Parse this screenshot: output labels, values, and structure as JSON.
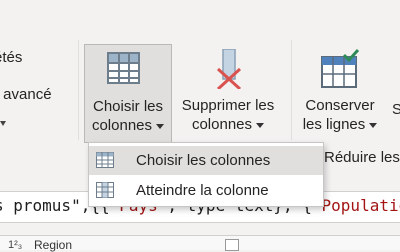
{
  "ribbon": {
    "left_clipped": {
      "line1": "étés",
      "line2": "r avancé"
    },
    "choose_columns": {
      "line1": "Choisir les",
      "line2": "colonnes"
    },
    "delete_columns": {
      "line1": "Supprimer les",
      "line2": "colonnes"
    },
    "keep_rows": {
      "line1": "Conserver",
      "line2": "les lignes"
    },
    "right_clipped": {
      "line1": "S"
    },
    "reduce_rows": "Réduire les"
  },
  "dropdown": {
    "items": [
      {
        "label": "Choisir les colonnes",
        "icon": "table-grid-icon"
      },
      {
        "label": "Atteindre la colonne",
        "icon": "column-grid-icon"
      }
    ]
  },
  "formula": {
    "text_start": "s promus\",{{\"",
    "str1": "Pays",
    "mid": "\", type text}, {\"",
    "str2": "Populatio"
  },
  "grid": {
    "header_icon": "1²₃",
    "column": "Region"
  },
  "colors": {
    "ribbon_bg": "#f3f2f1",
    "selected_bg": "#e1dfdd",
    "delete_x": "#d9534f",
    "keep_check": "#2e8b57",
    "table_header": "#9db3c8"
  }
}
